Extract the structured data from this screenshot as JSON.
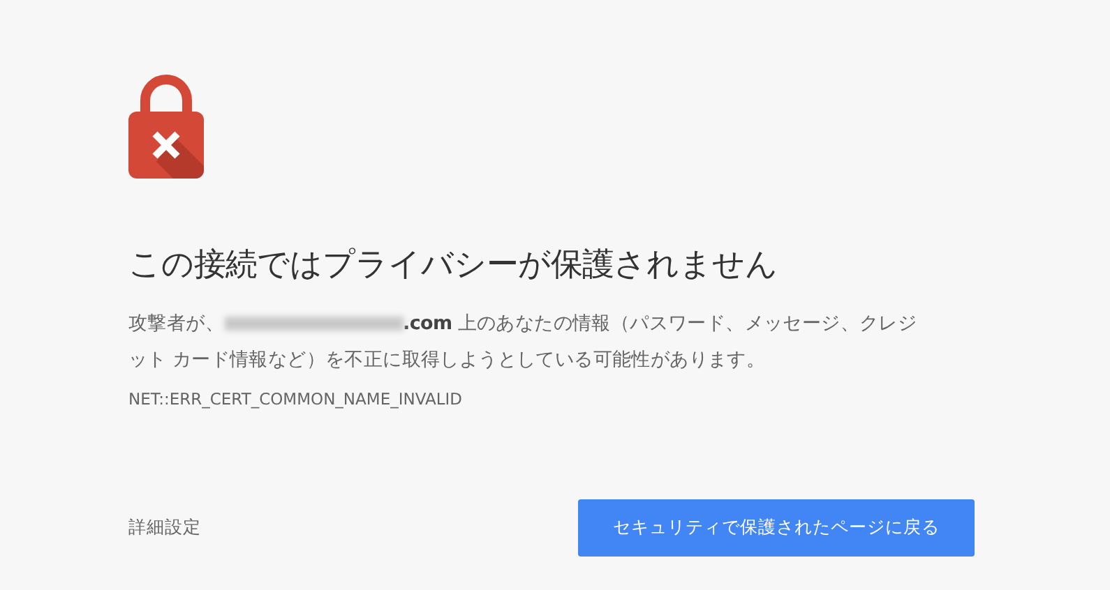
{
  "heading": "この接続ではプライバシーが保護されません",
  "message": {
    "before": "攻撃者が、",
    "redacted": true,
    "after": "**.com** 上のあなたの情報（パスワード、メッセージ、クレジット カード情報など）を不正に取得しようとしている可能性があります。"
  },
  "error_code": "NET::ERR_CERT_COMMON_NAME_INVALID",
  "details_link": "詳細設定",
  "back_button": "セキュリティで保護されたページに戻る"
}
